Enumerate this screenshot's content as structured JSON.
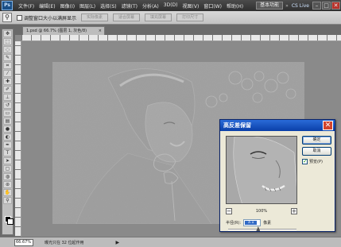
{
  "app": {
    "logo": "Ps",
    "menus": [
      "文件(F)",
      "编辑(E)",
      "图像(I)",
      "图层(L)",
      "选择(S)",
      "滤镜(T)",
      "分析(A)",
      "3D(D)",
      "视图(V)",
      "窗口(W)",
      "帮助(H)"
    ],
    "workspace_label": "基本功能",
    "workspace_more": "»",
    "cs_live": "CS Live",
    "win_min": "–",
    "win_max": "□",
    "win_close": "✕"
  },
  "options_bar": {
    "tool_icon": "zoom-tool-icon",
    "resize_windows_label": "调整窗口大小以满屏显示",
    "buttons": [
      "实际像素",
      "适合屏幕",
      "填充屏幕",
      "打印尺寸"
    ]
  },
  "document": {
    "tab_label": "1.psd @ 66.7% (图层 1, 灰色/8)",
    "tab_close": "×",
    "zoom": "66.67%",
    "status": "曝光只在 32 位起作用",
    "status_arrow": "▶"
  },
  "dialog": {
    "title": "高反差保留",
    "close": "✕",
    "ok_label": "确定",
    "reset_label": "取消",
    "preview_label": "预览(P)",
    "preview_checked": true,
    "zoom_out": "−",
    "zoom_value": "100%",
    "zoom_in": "+",
    "radius_label": "半径(R):",
    "radius_value": "3.1",
    "radius_unit": "像素",
    "radius_slider_position": 0.44
  },
  "colors": {
    "titlebar": "#3a3a3a",
    "dialog_title": "#0a3fa8",
    "close_red": "#d3442c",
    "selection": "#316ac5"
  }
}
